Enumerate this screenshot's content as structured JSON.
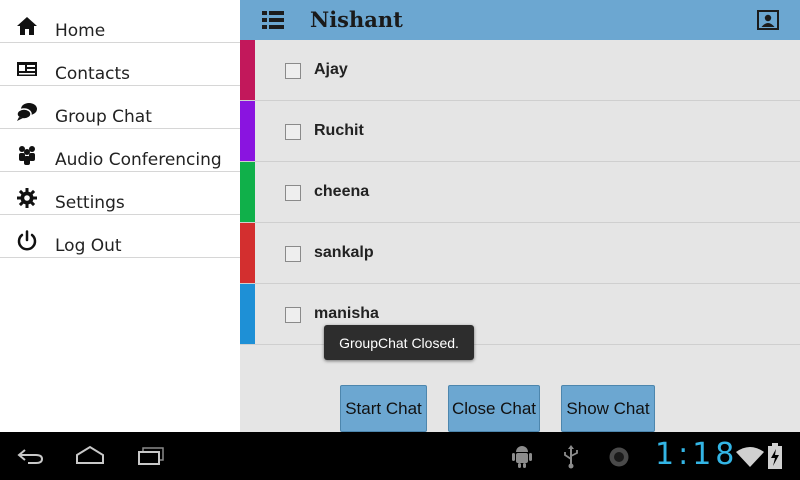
{
  "drawer": {
    "items": [
      {
        "label": "Home",
        "icon": "home-icon"
      },
      {
        "label": "Contacts",
        "icon": "contacts-icon"
      },
      {
        "label": "Group Chat",
        "icon": "chat-bubbles-icon"
      },
      {
        "label": "Audio Conferencing",
        "icon": "people-icon"
      },
      {
        "label": "Settings",
        "icon": "gear-icon"
      },
      {
        "label": "Log Out",
        "icon": "power-icon"
      }
    ]
  },
  "header": {
    "title": "Nishant",
    "menu_icon": "list-menu-icon",
    "profile_icon": "profile-card-icon"
  },
  "contacts": [
    {
      "name": "Ajay",
      "color": "#c2185b"
    },
    {
      "name": "Ruchit",
      "color": "#8a14e0"
    },
    {
      "name": "cheena",
      "color": "#10b04a"
    },
    {
      "name": "sankalp",
      "color": "#d32f2f"
    },
    {
      "name": "manisha",
      "color": "#1e90d6"
    }
  ],
  "buttons": {
    "start": "Start Chat",
    "close": "Close Chat",
    "show": "Show Chat"
  },
  "toast": "GroupChat Closed.",
  "statusbar": {
    "time": "1:18",
    "icons": [
      "back-icon",
      "home-nav-icon",
      "recent-apps-icon",
      "android-debug-icon",
      "usb-icon",
      "notification-dot-icon",
      "wifi-icon",
      "battery-charging-icon"
    ]
  },
  "colors": {
    "accent": "#6ca7d1",
    "clock": "#33b5e5"
  }
}
